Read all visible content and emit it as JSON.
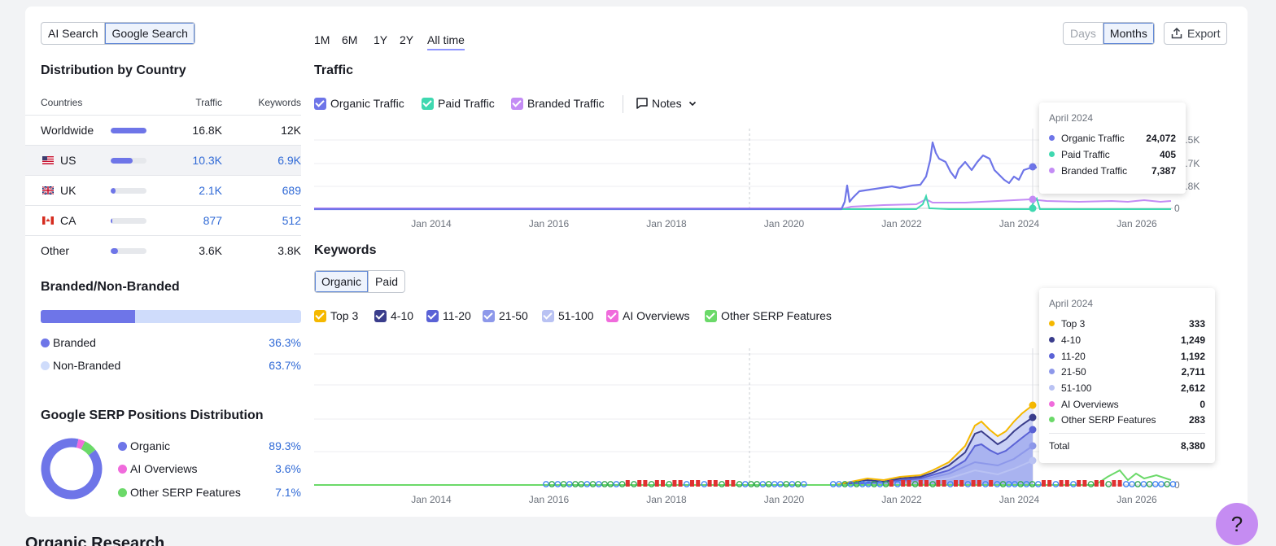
{
  "source_toggle": {
    "options": [
      "AI Search",
      "Google Search"
    ],
    "selected": "Google Search"
  },
  "periods": {
    "options": [
      "1M",
      "6M",
      "1Y",
      "2Y",
      "All time"
    ],
    "selected": "All time"
  },
  "granularity": {
    "options": [
      "Days",
      "Months"
    ],
    "selected": "Months"
  },
  "export_label": "Export",
  "distribution": {
    "title": "Distribution by Country",
    "headers": {
      "countries": "Countries",
      "traffic": "Traffic",
      "keywords": "Keywords"
    },
    "rows": [
      {
        "name": "Worldwide",
        "share": 1.0,
        "traffic": "16.8K",
        "keywords": "12K",
        "flag": ""
      },
      {
        "name": "US",
        "share": 0.61,
        "traffic": "10.3K",
        "keywords": "6.9K",
        "flag": "us"
      },
      {
        "name": "UK",
        "share": 0.13,
        "traffic": "2.1K",
        "keywords": "689",
        "flag": "uk"
      },
      {
        "name": "CA",
        "share": 0.05,
        "traffic": "877",
        "keywords": "512",
        "flag": "ca"
      },
      {
        "name": "Other",
        "share": 0.21,
        "traffic": "3.6K",
        "keywords": "3.8K",
        "flag": ""
      }
    ]
  },
  "branded": {
    "title": "Branded/Non-Branded",
    "branded_label": "Branded",
    "branded_pct": "36.3%",
    "branded_share": 0.363,
    "nonbranded_label": "Non-Branded",
    "nonbranded_pct": "63.7%",
    "colors": {
      "branded": "#6e75e8",
      "nonbranded": "#cfdcfb"
    }
  },
  "serp": {
    "title": "Google SERP Positions Distribution",
    "items": [
      {
        "label": "Organic",
        "pct": "89.3%",
        "value": 89.3,
        "color": "#6e75e8"
      },
      {
        "label": "AI Overviews",
        "pct": "3.6%",
        "value": 3.6,
        "color": "#f06bdc"
      },
      {
        "label": "Other SERP Features",
        "pct": "7.1%",
        "value": 7.1,
        "color": "#6bd969"
      }
    ]
  },
  "traffic": {
    "title": "Traffic",
    "series": [
      {
        "label": "Organic Traffic",
        "color": "#6e75e8"
      },
      {
        "label": "Paid Traffic",
        "color": "#3fd8b0"
      },
      {
        "label": "Branded Traffic",
        "color": "#c48cf5"
      }
    ],
    "notes_label": "Notes",
    "y_ticks": [
      "38.5K",
      "25.7K",
      "12.8K",
      "0"
    ],
    "x_ticks": [
      "Jan 2014",
      "Jan 2016",
      "Jan 2018",
      "Jan 2020",
      "Jan 2022",
      "Jan 2024",
      "Jan 2026"
    ],
    "tooltip": {
      "date": "April 2024",
      "rows": [
        {
          "label": "Organic Traffic",
          "value": "24,072",
          "color": "#6e75e8"
        },
        {
          "label": "Paid Traffic",
          "value": "405",
          "color": "#3fd8b0"
        },
        {
          "label": "Branded Traffic",
          "value": "7,387",
          "color": "#c48cf5"
        }
      ]
    }
  },
  "keywords": {
    "title": "Keywords",
    "tabs": [
      "Organic",
      "Paid"
    ],
    "selected_tab": "Organic",
    "series": [
      {
        "label": "Top 3",
        "color": "#f5b800"
      },
      {
        "label": "4-10",
        "color": "#3a3d8c"
      },
      {
        "label": "11-20",
        "color": "#5a62d6"
      },
      {
        "label": "21-50",
        "color": "#8d98ea"
      },
      {
        "label": "51-100",
        "color": "#b9c2f3"
      },
      {
        "label": "AI Overviews",
        "color": "#f06bdc"
      },
      {
        "label": "Other SERP Features",
        "color": "#6bd969"
      }
    ],
    "x_ticks": [
      "Jan 2014",
      "Jan 2016",
      "Jan 2018",
      "Jan 2020",
      "Jan 2022",
      "Jan 2024",
      "Jan 2026"
    ],
    "y_tick_zero": "0",
    "tooltip": {
      "date": "April 2024",
      "rows": [
        {
          "label": "Top 3",
          "value": "333",
          "color": "#f5b800"
        },
        {
          "label": "4-10",
          "value": "1,249",
          "color": "#3a3d8c"
        },
        {
          "label": "11-20",
          "value": "1,192",
          "color": "#5a62d6"
        },
        {
          "label": "21-50",
          "value": "2,711",
          "color": "#8d98ea"
        },
        {
          "label": "51-100",
          "value": "2,612",
          "color": "#b9c2f3"
        },
        {
          "label": "AI Overviews",
          "value": "0",
          "color": "#f06bdc"
        },
        {
          "label": "Other SERP Features",
          "value": "283",
          "color": "#6bd969"
        }
      ],
      "total_label": "Total",
      "total_value": "8,380"
    }
  },
  "next_section_title": "Organic Research",
  "help_label": "?"
}
